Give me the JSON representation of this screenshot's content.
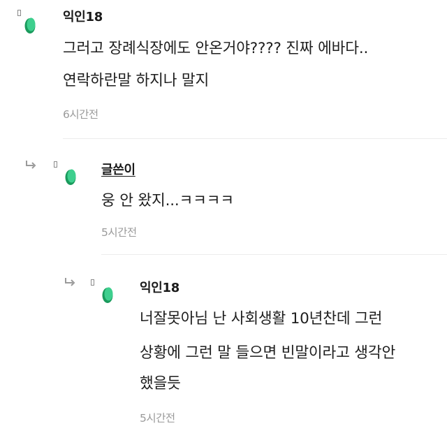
{
  "comments": [
    {
      "author": "익인18",
      "lines": [
        "그러고 장례식장에도 안온거야???? 진짜 에바다..",
        "연락하란말 하지나 말지"
      ],
      "time": "6시간전",
      "avatar_icon": "green-leaf-avatar-icon"
    },
    {
      "author": "글쓴이",
      "lines": [
        "웅 안 왔지...ㅋㅋㅋㅋ"
      ],
      "time": "5시간전",
      "avatar_icon": "green-leaf-avatar-icon",
      "reply_icon": "reply-arrow-icon"
    },
    {
      "author": "익인18",
      "lines": [
        "너잘못아님 난 사회생활 10년찬데 그런",
        "상황에 그런 말 들으면 빈말이라고 생각안",
        "했을듯"
      ],
      "time": "5시간전",
      "avatar_icon": "green-leaf-avatar-icon",
      "reply_icon": "reply-arrow-icon"
    }
  ],
  "colors": {
    "avatar_light": "#3ecf8e",
    "avatar_dark": "#1a9a5c",
    "text": "#1e1e1e",
    "time": "#9a9a9a",
    "divider": "#ececec"
  }
}
